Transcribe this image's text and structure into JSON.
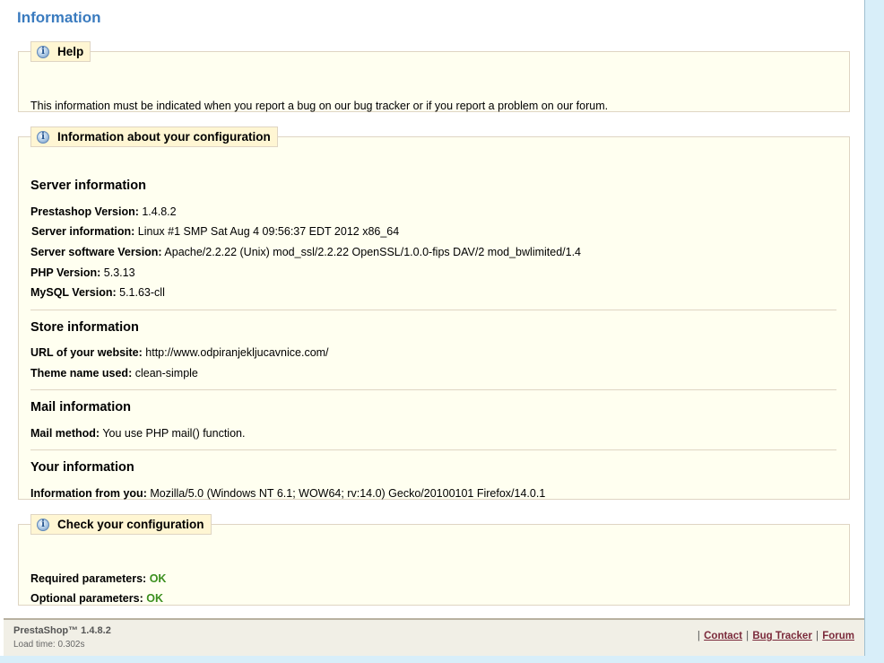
{
  "page": {
    "title": "Information"
  },
  "help": {
    "legend": "Help",
    "text": "This information must be indicated when you report a bug on our bug tracker or if you report a problem on our forum."
  },
  "config": {
    "legend": "Information about your configuration",
    "server": {
      "heading": "Server information",
      "rows": [
        {
          "label": "Prestashop Version:",
          "value": "1.4.8.2"
        },
        {
          "label": "Server information:",
          "value": "Linux #1 SMP Sat Aug 4 09:56:37 EDT 2012 x86_64"
        },
        {
          "label": "Server software Version:",
          "value": "Apache/2.2.22 (Unix) mod_ssl/2.2.22 OpenSSL/1.0.0-fips DAV/2 mod_bwlimited/1.4"
        },
        {
          "label": "PHP Version:",
          "value": "5.3.13"
        },
        {
          "label": "MySQL Version:",
          "value": "5.1.63-cll"
        }
      ]
    },
    "store": {
      "heading": "Store information",
      "rows": [
        {
          "label": "URL of your website:",
          "value": "http://www.odpiranjekljucavnice.com/"
        },
        {
          "label": "Theme name used:",
          "value": "clean-simple"
        }
      ]
    },
    "mail": {
      "heading": "Mail information",
      "rows": [
        {
          "label": "Mail method:",
          "value": "You use PHP mail() function."
        }
      ]
    },
    "you": {
      "heading": "Your information",
      "rows": [
        {
          "label": "Information from you:",
          "value": "Mozilla/5.0 (Windows NT 6.1; WOW64; rv:14.0) Gecko/20100101 Firefox/14.0.1"
        }
      ]
    }
  },
  "check": {
    "legend": "Check your configuration",
    "rows": [
      {
        "label": "Required parameters:",
        "value": "OK"
      },
      {
        "label": "Optional parameters:",
        "value": "OK"
      }
    ]
  },
  "footer": {
    "brand": "PrestaShop™ 1.4.8.2",
    "load_time": "Load time: 0.302s",
    "links": [
      "Contact",
      "Bug Tracker",
      "Forum"
    ],
    "separator": "|"
  },
  "colors": {
    "title": "#3a7bbf",
    "box_bg": "#fffff0",
    "legend_bg": "#fff6d3",
    "ok": "#3b8f1e",
    "link": "#7b2a3b"
  },
  "icons": {
    "legend_icon": "info-icon",
    "legend_icon_glyph": "i"
  }
}
